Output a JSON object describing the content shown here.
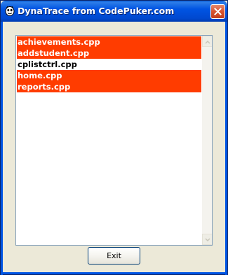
{
  "window": {
    "title": "DynaTrace from CodePuker.com",
    "close_icon": "close-icon",
    "app_icon": "app-icon"
  },
  "list": {
    "items": [
      {
        "label": "achievements.cpp",
        "selected": true
      },
      {
        "label": "addstudent.cpp",
        "selected": true
      },
      {
        "label": "cplistctrl.cpp",
        "selected": false
      },
      {
        "label": "home.cpp",
        "selected": true
      },
      {
        "label": "reports.cpp",
        "selected": true
      }
    ],
    "selected_color": "#ff3c00"
  },
  "buttons": {
    "exit_label": "Exit"
  }
}
